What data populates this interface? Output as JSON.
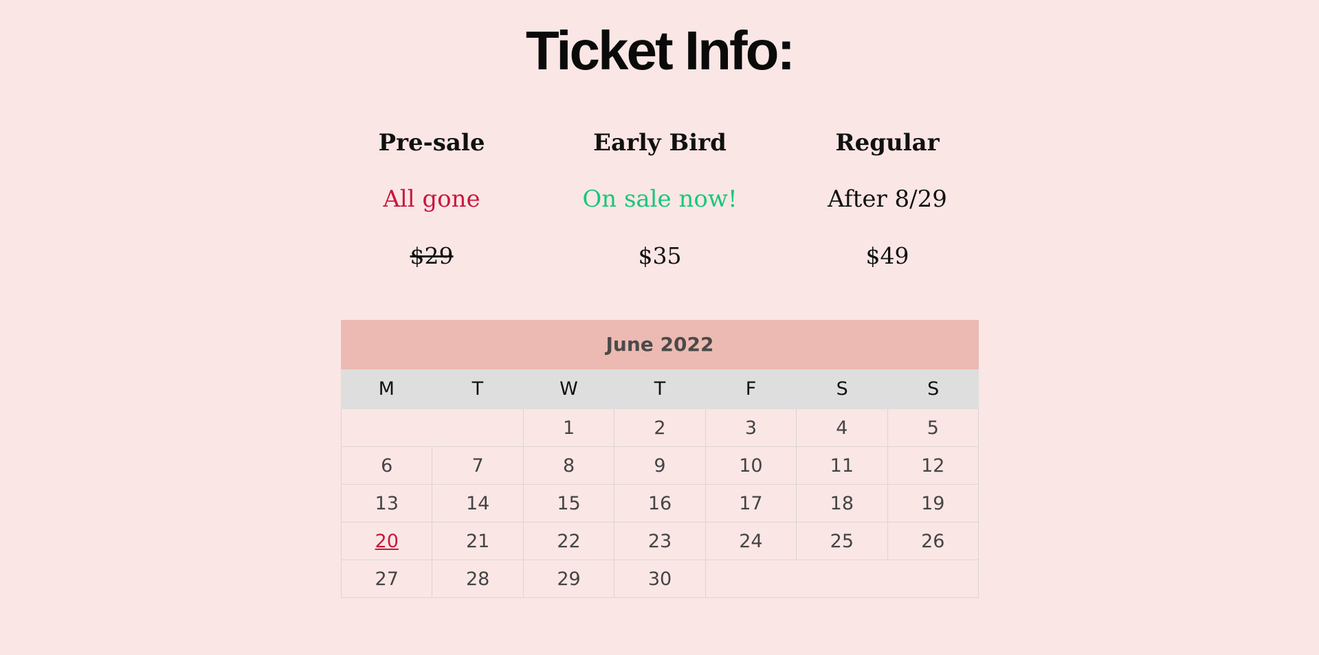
{
  "page": {
    "title": "Ticket Info:"
  },
  "tiers": [
    {
      "name": "Pre-sale",
      "status": "All gone",
      "status_color": "#c8173f",
      "price": "$29",
      "price_struck": true
    },
    {
      "name": "Early Bird",
      "status": "On sale now!",
      "status_color": "#18c77a",
      "price": "$35",
      "price_struck": false
    },
    {
      "name": "Regular",
      "status": "After 8/29",
      "status_color": "#111111",
      "price": "$49",
      "price_struck": false
    }
  ],
  "calendar": {
    "month_label": "June 2022",
    "header_color": "#ecbab2",
    "weekdays": [
      "M",
      "T",
      "W",
      "T",
      "F",
      "S",
      "S"
    ],
    "leading_blank_days": 2,
    "days_in_month": 30,
    "highlighted_day": "20",
    "highlight_color": "#c8173f"
  }
}
